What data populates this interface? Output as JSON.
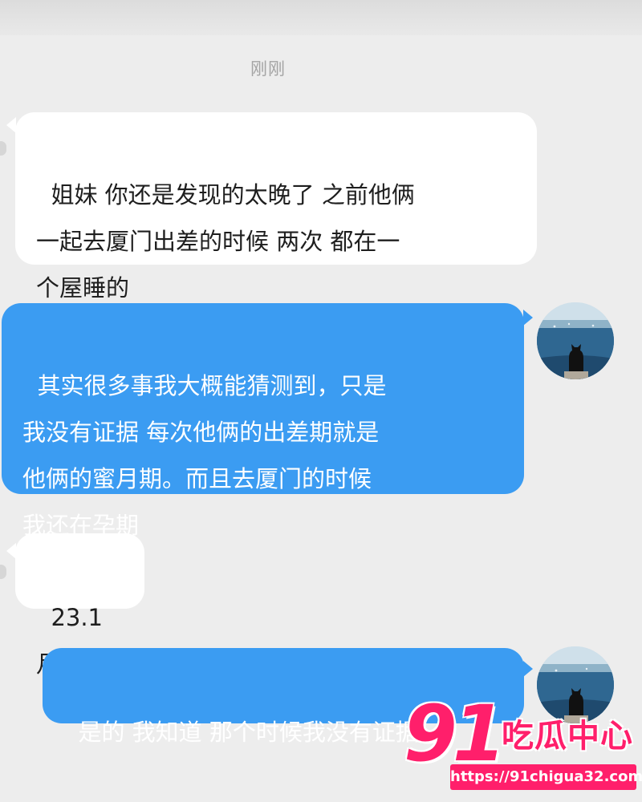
{
  "chat": {
    "timestamp": "刚刚",
    "messages": [
      {
        "side": "left",
        "text": "姐妹 你还是发现的太晚了 之前他俩\n一起去厦门出差的时候 两次 都在一\n个屋睡的"
      },
      {
        "side": "right",
        "text": "其实很多事我大概能猜测到，只是\n我没有证据 每次他俩的出差期就是\n他俩的蜜月期。而且去厦门的时候\n我还在孕期"
      },
      {
        "side": "left",
        "text": "23.1月"
      },
      {
        "side": "right",
        "text": "是的 我知道 那个时候我没有证据"
      }
    ]
  },
  "avatar": {
    "icon": "cat-by-sea-avatar"
  },
  "watermark": {
    "number": "91",
    "brand": "吃瓜中心",
    "url": "https://91chigua32.com"
  },
  "colors": {
    "background": "#ededed",
    "incoming_bubble": "#ffffff",
    "outgoing_bubble": "#3b9cf2",
    "watermark": "#ff1f6b"
  }
}
